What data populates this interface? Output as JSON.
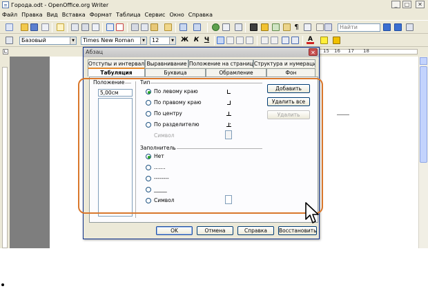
{
  "window": {
    "title": "Города.odt - OpenOffice.org Writer",
    "controls": {
      "minimize": "_",
      "maximize": "□",
      "close": "✕"
    }
  },
  "menubar": {
    "items": [
      {
        "label": "Файл"
      },
      {
        "label": "Правка"
      },
      {
        "label": "Вид"
      },
      {
        "label": "Вставка"
      },
      {
        "label": "Формат"
      },
      {
        "label": "Таблица"
      },
      {
        "label": "Сервис"
      },
      {
        "label": "Окно"
      },
      {
        "label": "Справка"
      }
    ]
  },
  "toolbar": {
    "find_placeholder": "Найти"
  },
  "formatting": {
    "style": "Базовый",
    "font": "Times New Roman",
    "size": "12",
    "bold": "Ж",
    "italic": "К",
    "underline": "Ч"
  },
  "ruler": {
    "numbers": [
      "15",
      "16",
      "17",
      "18"
    ]
  },
  "dialog": {
    "title": "Абзац",
    "close": "✕",
    "tabs_row1": [
      {
        "label": "Отступы и интервалы"
      },
      {
        "label": "Выравнивание"
      },
      {
        "label": "Положение на странице"
      },
      {
        "label": "Структура и нумерация"
      }
    ],
    "tabs_row2": [
      {
        "label": "Табуляция",
        "active": true
      },
      {
        "label": "Буквица"
      },
      {
        "label": "Обрамление"
      },
      {
        "label": "Фон"
      }
    ],
    "position": {
      "label": "Положение",
      "value": "5,00см"
    },
    "type": {
      "label": "Тип",
      "options": [
        {
          "label": "По левому краю",
          "selected": true
        },
        {
          "label": "По правому краю",
          "selected": false
        },
        {
          "label": "По центру",
          "selected": false
        },
        {
          "label": "По разделителю",
          "selected": false
        }
      ],
      "symbol_label": "Символ"
    },
    "fill": {
      "label": "Заполнитель",
      "options": [
        {
          "label": "Нет",
          "selected": true
        },
        {
          "label": ".......",
          "selected": false
        },
        {
          "label": "--------",
          "selected": false
        },
        {
          "label": "_____",
          "selected": false
        },
        {
          "label": "Символ",
          "selected": false
        }
      ]
    },
    "side_buttons": {
      "add": "Добавить",
      "delete_all": "Удалить все",
      "delete": "Удалить"
    },
    "footer_buttons": {
      "ok": "OK",
      "cancel": "Отмена",
      "help": "Справка",
      "reset": "Восстановить"
    }
  },
  "colors": {
    "highlight": "#d9772b",
    "active_tab_accent": "#e68b2c",
    "dialog_border": "#0b2e8a"
  }
}
